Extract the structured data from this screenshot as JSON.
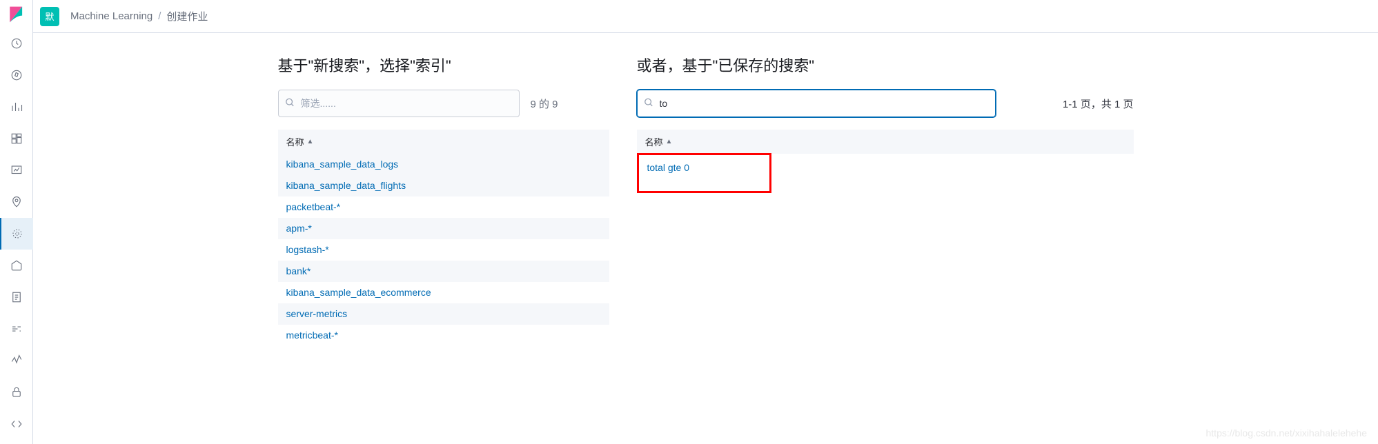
{
  "space_badge": "默",
  "breadcrumb": {
    "item1": "Machine Learning",
    "sep": "/",
    "item2": "创建作业"
  },
  "left_panel": {
    "title": "基于\"新搜索\"，选择\"索引\"",
    "search_placeholder": "筛选......",
    "count": "9 的 9",
    "column_header": "名称",
    "rows": [
      "kibana_sample_data_logs",
      "kibana_sample_data_flights",
      "packetbeat-*",
      "apm-*",
      "logstash-*",
      "bank*",
      "kibana_sample_data_ecommerce",
      "server-metrics",
      "metricbeat-*"
    ]
  },
  "right_panel": {
    "title": "或者，基于\"已保存的搜索\"",
    "search_value": "to",
    "page_info": "1-1 页，共 1 页",
    "column_header": "名称",
    "result": "total gte 0"
  },
  "watermark": "https://blog.csdn.net/xixihahalelehehe"
}
